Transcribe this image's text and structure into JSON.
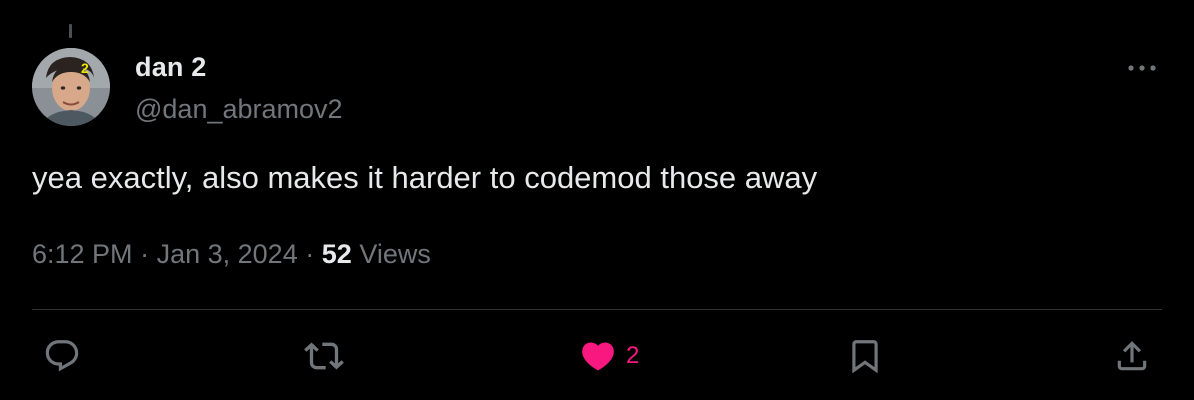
{
  "tweet": {
    "author": {
      "display_name": "dan 2",
      "handle": "@dan_abramov2",
      "avatar_badge": "2"
    },
    "text": "yea exactly, also makes it harder to codemod those away",
    "time": "6:12 PM",
    "date": "Jan 3, 2024",
    "views_count": "52",
    "views_label": "Views",
    "separator": "·"
  },
  "actions": {
    "reply_icon": "reply-icon",
    "repost_icon": "repost-icon",
    "like_icon": "heart-filled-icon",
    "like_count": "2",
    "bookmark_icon": "bookmark-icon",
    "share_icon": "share-icon",
    "more_icon": "more-horizontal-icon"
  },
  "colors": {
    "background": "#000000",
    "primary_text": "#e7e9ea",
    "secondary_text": "#71767b",
    "like_pink": "#f91880",
    "divider": "#2f3336",
    "badge_yellow": "#f2e600"
  }
}
